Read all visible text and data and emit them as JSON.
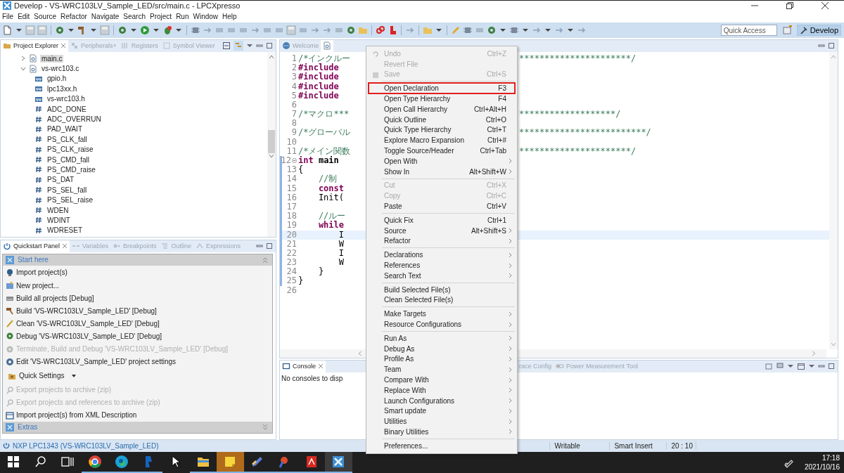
{
  "window": {
    "title": "Develop - VS-WRC103LV_Sample_LED/src/main.c - LPCXpresso"
  },
  "menubar": [
    "File",
    "Edit",
    "Source",
    "Refactor",
    "Navigate",
    "Search",
    "Project",
    "Run",
    "Window",
    "Help"
  ],
  "toolbar": {
    "quick_access": {
      "placeholder": "Quick Access"
    },
    "perspective": {
      "label": "Develop",
      "selected": true
    }
  },
  "explorer": {
    "tabs": [
      {
        "label": "Project Explorer",
        "selected": true
      },
      {
        "label": "Peripherals+",
        "selected": false
      },
      {
        "label": "Registers",
        "selected": false
      },
      {
        "label": "Symbol Viewer",
        "selected": false
      }
    ],
    "tree": [
      {
        "label": "main.c",
        "kind": "source",
        "expanded": false,
        "selected": true
      },
      {
        "label": "vs-wrc103.c",
        "kind": "source",
        "expanded": true,
        "selected": false,
        "children": [
          {
            "label": "gpio.h",
            "kind": "include",
            "selected": false
          },
          {
            "label": "lpc13xx.h",
            "kind": "include",
            "selected": false
          },
          {
            "label": "vs-wrc103.h",
            "kind": "include",
            "selected": false
          },
          {
            "label": "ADC_DONE",
            "kind": "macro",
            "selected": false
          },
          {
            "label": "ADC_OVERRUN",
            "kind": "macro",
            "selected": false
          },
          {
            "label": "PAD_WAIT",
            "kind": "macro",
            "selected": false
          },
          {
            "label": "PS_CLK_fall",
            "kind": "macro",
            "selected": false
          },
          {
            "label": "PS_CLK_raise",
            "kind": "macro",
            "selected": false
          },
          {
            "label": "PS_CMD_fall",
            "kind": "macro",
            "selected": false
          },
          {
            "label": "PS_CMD_raise",
            "kind": "macro",
            "selected": false
          },
          {
            "label": "PS_DAT",
            "kind": "macro",
            "selected": false
          },
          {
            "label": "PS_SEL_fall",
            "kind": "macro",
            "selected": false
          },
          {
            "label": "PS_SEL_raise",
            "kind": "macro",
            "selected": false
          },
          {
            "label": "WDEN",
            "kind": "macro",
            "selected": false
          },
          {
            "label": "WDINT",
            "kind": "macro",
            "selected": false
          },
          {
            "label": "WDRESET",
            "kind": "macro",
            "selected": false
          }
        ]
      }
    ]
  },
  "quickstart": {
    "tabs": [
      {
        "label": "Quickstart Panel",
        "selected": true
      },
      {
        "label": "Variables",
        "selected": false
      },
      {
        "label": "Breakpoints",
        "selected": false
      },
      {
        "label": "Outline",
        "selected": false
      },
      {
        "label": "Expressions",
        "selected": false
      }
    ],
    "sections": [
      {
        "title": "Start here",
        "expanded": true,
        "items": [
          {
            "label": "Import project(s)",
            "kind": "action",
            "disabled": false
          },
          {
            "label": "New project...",
            "kind": "action",
            "disabled": false
          },
          {
            "label": "Build all projects [Debug]",
            "kind": "action",
            "disabled": false
          },
          {
            "label": "Build 'VS-WRC103LV_Sample_LED' [Debug]",
            "kind": "action",
            "disabled": false
          },
          {
            "label": "Clean 'VS-WRC103LV_Sample_LED' [Debug]",
            "kind": "action",
            "disabled": false
          },
          {
            "label": "Debug 'VS-WRC103LV_Sample_LED' [Debug]",
            "kind": "action",
            "disabled": false
          },
          {
            "label": "Terminate, Build and Debug 'VS-WRC103LV_Sample_LED' [Debug]",
            "kind": "action",
            "disabled": true
          },
          {
            "label": "Edit 'VS-WRC103LV_Sample_LED' project settings",
            "kind": "action",
            "disabled": false
          },
          {
            "label": "Quick Settings",
            "kind": "dropdown",
            "disabled": false
          },
          {
            "label": "Export projects to archive (zip)",
            "kind": "action",
            "disabled": true
          },
          {
            "label": "Export projects and references to archive (zip)",
            "kind": "action",
            "disabled": true
          },
          {
            "label": "Import project(s) from XML Description",
            "kind": "action",
            "disabled": false
          }
        ]
      },
      {
        "title": "Extras",
        "expanded": false
      }
    ]
  },
  "editor": {
    "tabs": [
      {
        "label": "Welcome",
        "selected": false
      },
      {
        "selected": true
      }
    ],
    "lines": [
      {
        "number": "1",
        "tokens": [
          {
            "text": "/*インクルー",
            "kind": "comment"
          }
        ],
        "tail": "**********************/",
        "changed": false,
        "current": false
      },
      {
        "number": "2",
        "tokens": [
          {
            "text": "#include",
            "kind": "keyword"
          }
        ],
        "changed": false,
        "current": false
      },
      {
        "number": "3",
        "tokens": [
          {
            "text": "#include",
            "kind": "keyword"
          }
        ],
        "changed": false,
        "current": false
      },
      {
        "number": "4",
        "tokens": [
          {
            "text": "#include",
            "kind": "keyword"
          }
        ],
        "changed": false,
        "current": false
      },
      {
        "number": "5",
        "tokens": [
          {
            "text": "#include",
            "kind": "keyword"
          }
        ],
        "changed": false,
        "current": false
      },
      {
        "number": "6",
        "changed": false,
        "current": false
      },
      {
        "number": "7",
        "tokens": [
          {
            "text": "/*マクロ***",
            "kind": "comment"
          }
        ],
        "tail": "*******************/",
        "changed": false,
        "current": false
      },
      {
        "number": "8",
        "changed": false,
        "current": false
      },
      {
        "number": "9",
        "tokens": [
          {
            "text": "/*グローバル",
            "kind": "comment"
          }
        ],
        "tail": "*************************/",
        "changed": false,
        "current": false
      },
      {
        "number": "10",
        "changed": false,
        "current": false
      },
      {
        "number": "11",
        "tokens": [
          {
            "text": "/*メイン関数",
            "kind": "comment"
          }
        ],
        "tail": "**********************/",
        "changed": false,
        "current": false
      },
      {
        "number": "12",
        "tokens": [
          {
            "text": "int",
            "kind": "keyword"
          },
          {
            "text": " main",
            "kind": "name"
          }
        ],
        "foldable": true,
        "changed": true,
        "current": false
      },
      {
        "number": "13",
        "tokens": [
          {
            "text": "{",
            "kind": "plain"
          }
        ],
        "changed": true,
        "current": false
      },
      {
        "number": "14",
        "tokens": [
          {
            "text": "    //制",
            "kind": "comment"
          }
        ],
        "changed": true,
        "current": false
      },
      {
        "number": "15",
        "tokens": [
          {
            "text": "    const",
            "kind": "keyword"
          }
        ],
        "changed": true,
        "current": false
      },
      {
        "number": "16",
        "tokens": [
          {
            "text": "    Init(",
            "kind": "plain"
          }
        ],
        "changed": true,
        "current": false
      },
      {
        "number": "17",
        "changed": true,
        "current": false
      },
      {
        "number": "18",
        "tokens": [
          {
            "text": "    //ルー",
            "kind": "comment"
          }
        ],
        "changed": true,
        "current": false
      },
      {
        "number": "19",
        "tokens": [
          {
            "text": "    while",
            "kind": "keyword"
          }
        ],
        "changed": true,
        "current": false
      },
      {
        "number": "20",
        "tokens": [
          {
            "text": "        I",
            "kind": "plain"
          }
        ],
        "changed": true,
        "current": true
      },
      {
        "number": "21",
        "tokens": [
          {
            "text": "        W",
            "kind": "plain"
          }
        ],
        "changed": true,
        "current": false
      },
      {
        "number": "22",
        "tokens": [
          {
            "text": "        I",
            "kind": "plain"
          }
        ],
        "changed": true,
        "current": false
      },
      {
        "number": "23",
        "tokens": [
          {
            "text": "        W",
            "kind": "plain"
          }
        ],
        "changed": true,
        "current": false
      },
      {
        "number": "24",
        "tokens": [
          {
            "text": "    }",
            "kind": "plain"
          }
        ],
        "changed": true,
        "current": false
      },
      {
        "number": "25",
        "tokens": [
          {
            "text": "}",
            "kind": "plain"
          }
        ],
        "changed": true,
        "current": false
      },
      {
        "number": "26",
        "changed": false,
        "current": false
      }
    ]
  },
  "console": {
    "tabs": [
      {
        "label": "Console",
        "selected": true
      },
      {
        "label": "race Config",
        "selected": false
      },
      {
        "label": "Power Measurement Tool",
        "selected": false
      }
    ],
    "message": "No consoles to disp"
  },
  "context_menu": {
    "groups": [
      [
        {
          "label": "Undo",
          "shortcut": "Ctrl+Z",
          "disabled": true,
          "submenu": false,
          "highlighted": false
        },
        {
          "label": "Revert File",
          "disabled": true,
          "submenu": false,
          "highlighted": false
        },
        {
          "label": "Save",
          "shortcut": "Ctrl+S",
          "disabled": true,
          "submenu": false,
          "highlighted": false
        }
      ],
      [
        {
          "label": "Open Declaration",
          "shortcut": "F3",
          "disabled": false,
          "submenu": false,
          "highlighted": true
        },
        {
          "label": "Open Type Hierarchy",
          "shortcut": "F4",
          "disabled": false,
          "submenu": false,
          "highlighted": false
        },
        {
          "label": "Open Call Hierarchy",
          "shortcut": "Ctrl+Alt+H",
          "disabled": false,
          "submenu": false,
          "highlighted": false
        },
        {
          "label": "Quick Outline",
          "shortcut": "Ctrl+O",
          "disabled": false,
          "submenu": false,
          "highlighted": false
        },
        {
          "label": "Quick Type Hierarchy",
          "shortcut": "Ctrl+T",
          "disabled": false,
          "submenu": false,
          "highlighted": false
        },
        {
          "label": "Explore Macro Expansion",
          "shortcut": "Ctrl+#",
          "disabled": false,
          "submenu": false,
          "highlighted": false
        },
        {
          "label": "Toggle Source/Header",
          "shortcut": "Ctrl+Tab",
          "disabled": false,
          "submenu": false,
          "highlighted": false
        },
        {
          "label": "Open With",
          "disabled": false,
          "submenu": true,
          "highlighted": false
        },
        {
          "label": "Show In",
          "shortcut": "Alt+Shift+W",
          "disabled": false,
          "submenu": true,
          "highlighted": false
        }
      ],
      [
        {
          "label": "Cut",
          "shortcut": "Ctrl+X",
          "disabled": true,
          "submenu": false,
          "highlighted": false
        },
        {
          "label": "Copy",
          "shortcut": "Ctrl+C",
          "disabled": true,
          "submenu": false,
          "highlighted": false
        },
        {
          "label": "Paste",
          "shortcut": "Ctrl+V",
          "disabled": false,
          "submenu": false,
          "highlighted": false
        }
      ],
      [
        {
          "label": "Quick Fix",
          "shortcut": "Ctrl+1",
          "disabled": false,
          "submenu": false,
          "highlighted": false
        },
        {
          "label": "Source",
          "shortcut": "Alt+Shift+S",
          "disabled": false,
          "submenu": true,
          "highlighted": false
        },
        {
          "label": "Refactor",
          "disabled": false,
          "submenu": true,
          "highlighted": false
        }
      ],
      [
        {
          "label": "Declarations",
          "disabled": false,
          "submenu": true,
          "highlighted": false
        },
        {
          "label": "References",
          "disabled": false,
          "submenu": true,
          "highlighted": false
        },
        {
          "label": "Search Text",
          "disabled": false,
          "submenu": true,
          "highlighted": false
        }
      ],
      [
        {
          "label": "Build Selected File(s)",
          "disabled": false,
          "submenu": false,
          "highlighted": false
        },
        {
          "label": "Clean Selected File(s)",
          "disabled": false,
          "submenu": false,
          "highlighted": false
        }
      ],
      [
        {
          "label": "Make Targets",
          "disabled": false,
          "submenu": true,
          "highlighted": false
        },
        {
          "label": "Resource Configurations",
          "disabled": false,
          "submenu": true,
          "highlighted": false
        }
      ],
      [
        {
          "label": "Run As",
          "disabled": false,
          "submenu": true,
          "highlighted": false
        },
        {
          "label": "Debug As",
          "disabled": false,
          "submenu": true,
          "highlighted": false
        },
        {
          "label": "Profile As",
          "disabled": false,
          "submenu": true,
          "highlighted": false
        },
        {
          "label": "Team",
          "disabled": false,
          "submenu": true,
          "highlighted": false
        },
        {
          "label": "Compare With",
          "disabled": false,
          "submenu": true,
          "highlighted": false
        },
        {
          "label": "Replace With",
          "disabled": false,
          "submenu": true,
          "highlighted": false
        },
        {
          "label": "Launch Configurations",
          "disabled": false,
          "submenu": true,
          "highlighted": false
        },
        {
          "label": "Smart update",
          "disabled": false,
          "submenu": true,
          "highlighted": false
        },
        {
          "label": "Utilities",
          "disabled": false,
          "submenu": true,
          "highlighted": false
        },
        {
          "label": "Binary Utilities",
          "disabled": false,
          "submenu": true,
          "highlighted": false
        }
      ],
      [
        {
          "label": "Preferences...",
          "disabled": false,
          "submenu": false,
          "highlighted": false
        }
      ]
    ]
  },
  "status_bar": {
    "target": "NXP LPC1343 (VS-WRC103LV_Sample_LED)",
    "fields": [
      "Writable",
      "Smart Insert",
      "20 : 10"
    ]
  },
  "taskbar": {
    "apps": [
      {
        "running": false,
        "selected": false
      },
      {
        "running": false,
        "selected": false
      },
      {
        "running": false,
        "selected": false
      },
      {
        "running": true,
        "selected": false
      },
      {
        "running": true,
        "selected": false
      },
      {
        "running": true,
        "selected": false
      },
      {
        "running": false,
        "selected": false
      },
      {
        "running": true,
        "selected": false
      },
      {
        "running": true,
        "selected": true
      },
      {
        "running": true,
        "selected": false
      },
      {
        "running": true,
        "selected": false
      },
      {
        "running": true,
        "selected": false
      },
      {
        "running": true,
        "selected": true
      }
    ],
    "time": "17:18",
    "date": "2021/10/16"
  }
}
